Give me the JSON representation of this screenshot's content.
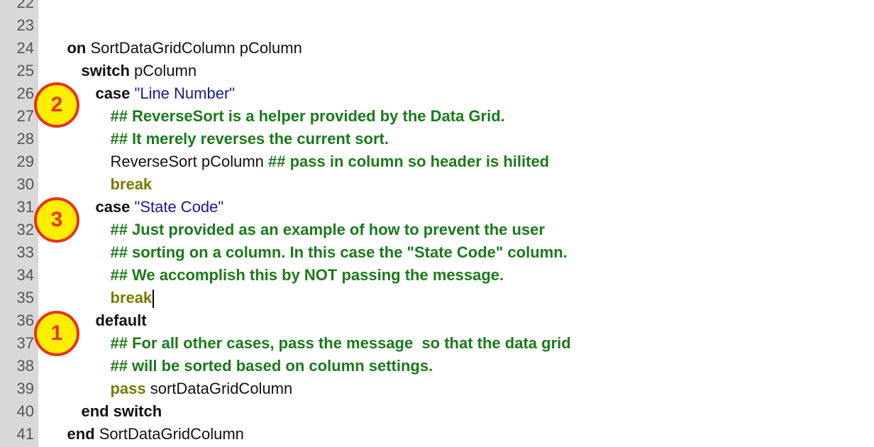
{
  "editor": {
    "line_numbers": [
      "22",
      "23",
      "24",
      "25",
      "26",
      "27",
      "28",
      "29",
      "30",
      "31",
      "32",
      "33",
      "34",
      "35",
      "36",
      "37",
      "38",
      "39",
      "40",
      "41"
    ],
    "lines": {
      "l23": {
        "kw": "on",
        "rest": " SortDataGridColumn pColumn"
      },
      "l24": {
        "kw": "switch",
        "rest": " pColumn"
      },
      "l25": {
        "kw": "case",
        "str": " \"Line Number\""
      },
      "l26": {
        "comment": "## ReverseSort is a helper provided by the Data Grid."
      },
      "l27": {
        "comment": "## It merely reverses the current sort."
      },
      "l28": {
        "plain": "ReverseSort pColumn ",
        "comment": "## pass in column so header is hilited"
      },
      "l29": {
        "kw": "break"
      },
      "l30": {
        "kw": "case",
        "str": " \"State Code\""
      },
      "l31": {
        "comment": "## Just provided as an example of how to prevent the user"
      },
      "l32": {
        "comment": "## sorting on a column. In this case the \"State Code\" column."
      },
      "l33": {
        "comment": "## We accomplish this by NOT passing the message."
      },
      "l34": {
        "kw": "break"
      },
      "l35": {
        "kw": "default"
      },
      "l36": {
        "comment": "## For all other cases, pass the message  so that the data grid"
      },
      "l37": {
        "comment": "## will be sorted based on column settings."
      },
      "l38": {
        "kw": "pass",
        "rest": " sortDataGridColumn"
      },
      "l39": {
        "kw": "end switch"
      },
      "l40": {
        "kw": "end",
        "rest": " SortDataGridColumn"
      }
    }
  },
  "badges": {
    "b1": "1",
    "b2": "2",
    "b3": "3"
  },
  "colors": {
    "gutter": "#d8d8d8",
    "keyword_dark": "#111111",
    "keyword_olive": "#7a7a00",
    "string": "#1a1a8a",
    "comment": "#1a7a1a",
    "badge_fill": "#ffee00",
    "badge_border": "#e8331e"
  }
}
